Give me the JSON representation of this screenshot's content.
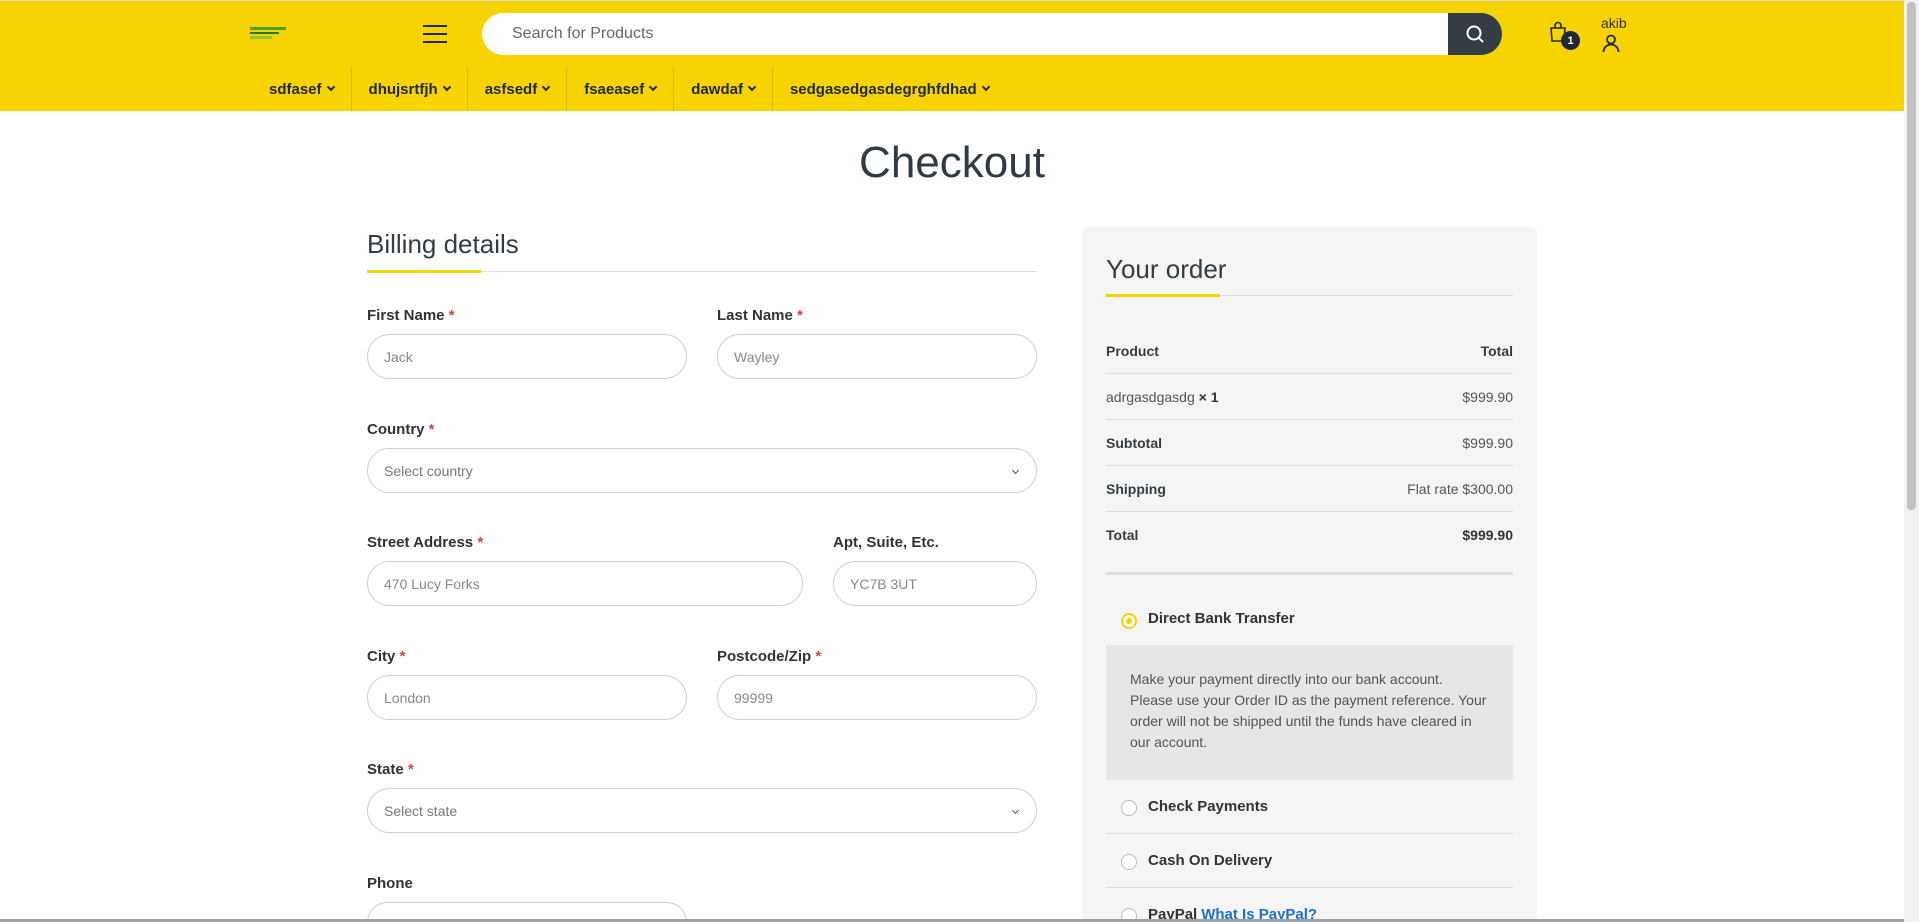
{
  "header": {
    "search_placeholder": "Search for Products",
    "cart_count": "1",
    "user_name": "akib"
  },
  "nav": [
    {
      "label": "sdfasef"
    },
    {
      "label": "dhujsrtfjh"
    },
    {
      "label": "asfsedf"
    },
    {
      "label": "fsaeasef"
    },
    {
      "label": "dawdaf"
    },
    {
      "label": "sedgasedgasdegrghfdhad"
    }
  ],
  "page_title": "Checkout",
  "billing": {
    "title": "Billing details",
    "first_name_label": "First Name",
    "first_name_placeholder": "Jack",
    "last_name_label": "Last Name",
    "last_name_placeholder": "Wayley",
    "country_label": "Country",
    "country_value": "Select country",
    "street_label": "Street Address",
    "street_placeholder": "470 Lucy Forks",
    "apt_label": "Apt, Suite, Etc.",
    "apt_placeholder": "YC7B 3UT",
    "city_label": "City",
    "city_placeholder": "London",
    "postcode_label": "Postcode/Zip",
    "postcode_placeholder": "99999",
    "state_label": "State",
    "state_value": "Select state",
    "phone_label": "Phone",
    "required_mark": "*"
  },
  "order": {
    "title": "Your order",
    "product_header": "Product",
    "total_header": "Total",
    "item_name": "adrgasdgasdg",
    "item_qty": "× 1",
    "item_total": "$999.90",
    "subtotal_label": "Subtotal",
    "subtotal_value": "$999.90",
    "shipping_label": "Shipping",
    "shipping_value": "Flat rate $300.00",
    "total_label": "Total",
    "total_value": "$999.90"
  },
  "payment": {
    "bank_label": "Direct Bank Transfer",
    "bank_desc": "Make your payment directly into our bank account. Please use your Order ID as the payment reference. Your order will not be shipped until the funds have cleared in our account.",
    "check_label": "Check Payments",
    "cod_label": "Cash On Delivery",
    "paypal_label": "PayPal",
    "paypal_link": "What Is PayPal?"
  },
  "colors": {
    "brand_yellow": "#f7d302",
    "dark": "#333d43",
    "required_red": "#e23c3c",
    "link_blue": "#1c6fd1"
  }
}
